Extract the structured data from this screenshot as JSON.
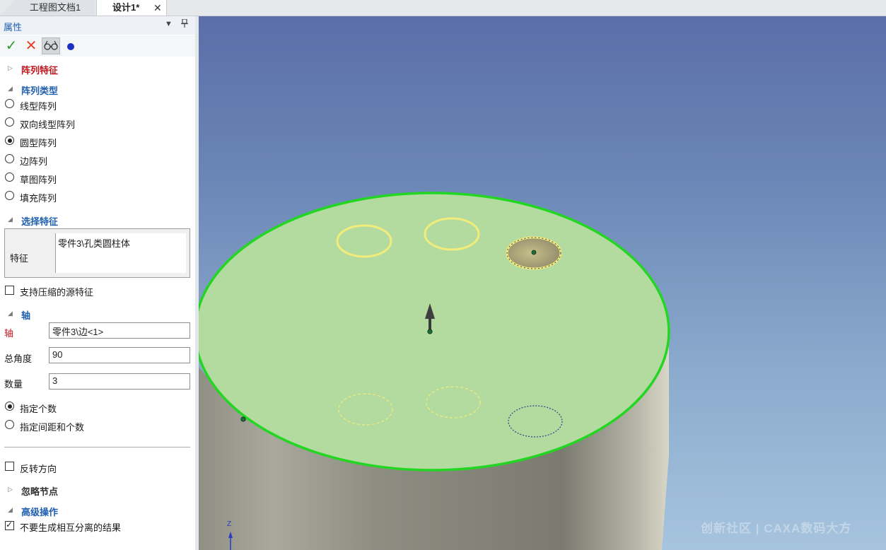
{
  "tabs": [
    {
      "label": "工程图文档1",
      "active": false
    },
    {
      "label": "设计1*",
      "active": true,
      "close": "✕"
    }
  ],
  "panel": {
    "title": "属性",
    "dropdown_icon": "▼",
    "pin_icon": "📌",
    "toolbar": {
      "ok": "✓",
      "cancel": "✕",
      "preview": "glasses-icon",
      "dot": "blue-dot"
    }
  },
  "sections": {
    "pattern_feature": "阵列特征",
    "pattern_type": "阵列类型",
    "select_feature": "选择特征",
    "axis": "轴",
    "ignore_nodes": "忽略节点",
    "advanced": "高级操作"
  },
  "pattern_types": [
    {
      "label": "线型阵列",
      "selected": false
    },
    {
      "label": "双向线型阵列",
      "selected": false
    },
    {
      "label": "圆型阵列",
      "selected": true
    },
    {
      "label": "边阵列",
      "selected": false
    },
    {
      "label": "草图阵列",
      "selected": false
    },
    {
      "label": "填充阵列",
      "selected": false
    }
  ],
  "feature": {
    "label": "特征",
    "value": "零件3\\孔类圆柱体"
  },
  "support_compressed": {
    "label": "支持压缩的源特征",
    "checked": false
  },
  "axis": {
    "axis_label": "轴",
    "axis_value": "零件3\\边<1>",
    "angle_label": "总角度",
    "angle_value": "90",
    "count_label": "数量",
    "count_value": "3"
  },
  "count_mode": [
    {
      "label": "指定个数",
      "selected": true
    },
    {
      "label": "指定间距和个数",
      "selected": false
    }
  ],
  "reverse": {
    "label": "反转方向",
    "checked": false
  },
  "no_separate": {
    "label": "不要生成相互分离的结果",
    "checked": true
  },
  "viewport": {
    "watermark": "创新社区 | CAXA数码大方",
    "axis_z": "Z",
    "face_color": "#b3dba0",
    "edge_color": "#22d622",
    "hole_color": "#f2ec7a"
  }
}
